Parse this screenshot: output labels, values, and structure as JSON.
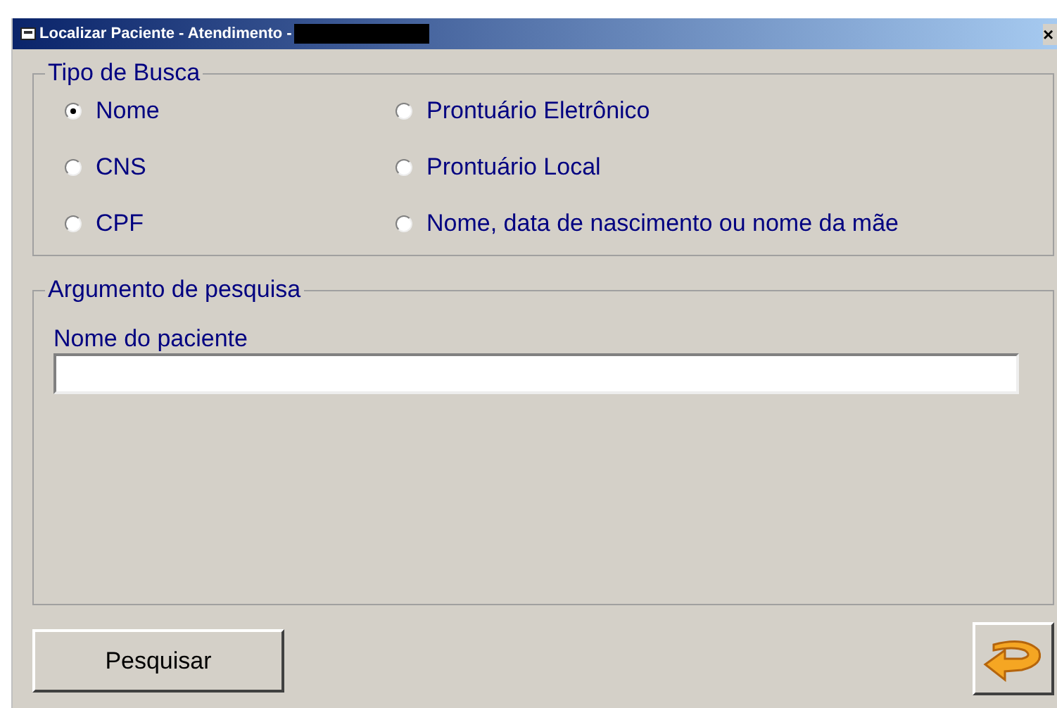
{
  "window": {
    "title": "Localizar Paciente - Atendimento -",
    "close": "×"
  },
  "search_type": {
    "legend": "Tipo de Busca",
    "options": [
      {
        "label": "Nome",
        "selected": true
      },
      {
        "label": "Prontuário Eletrônico",
        "selected": false
      },
      {
        "label": "CNS",
        "selected": false
      },
      {
        "label": "Prontuário Local",
        "selected": false
      },
      {
        "label": "CPF",
        "selected": false
      },
      {
        "label": "Nome, data de nascimento ou nome da mãe",
        "selected": false
      }
    ]
  },
  "argument": {
    "legend": "Argumento de pesquisa",
    "field_label": "Nome do paciente"
  },
  "buttons": {
    "search": "Pesquisar"
  }
}
